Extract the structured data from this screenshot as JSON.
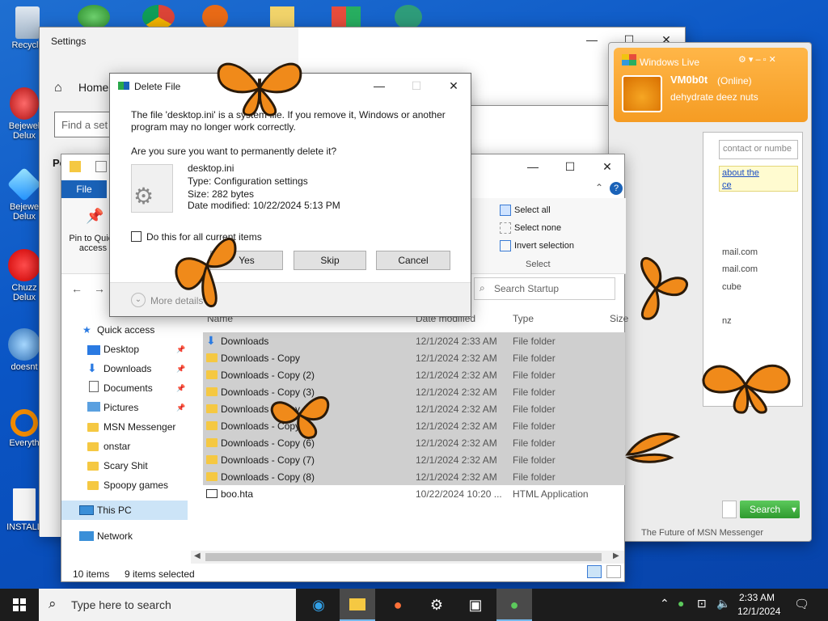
{
  "desktop": {
    "icons": [
      {
        "label": "Recycle"
      },
      {
        "label": "Bejewel\nDelux"
      },
      {
        "label": "Bejewe\nDelux"
      },
      {
        "label": "Chuzz\nDelux"
      },
      {
        "label": "doesnt"
      },
      {
        "label": "Everyth"
      },
      {
        "label": "INSTALL"
      }
    ]
  },
  "settings": {
    "title": "Settings",
    "home": "Home",
    "search_placeholder": "Find a set",
    "partial_label": "Pe"
  },
  "explorer": {
    "ribbon_file": "File",
    "pin_label": "Pin to Quick access",
    "select_all": "Select all",
    "select_none": "Select none",
    "invert_selection": "Invert selection",
    "select_group": "Select",
    "search_placeholder": "Search Startup",
    "columns": {
      "name": "Name",
      "date": "Date modified",
      "type": "Type",
      "size": "Size"
    },
    "nav": {
      "quick_access": "Quick access",
      "items": [
        "Desktop",
        "Downloads",
        "Documents",
        "Pictures",
        "MSN Messenger",
        "onstar",
        "Scary Shit",
        "Spoopy games"
      ],
      "this_pc": "This PC",
      "network": "Network"
    },
    "files": [
      {
        "name": "Downloads",
        "date": "12/1/2024 2:33 AM",
        "type": "File folder"
      },
      {
        "name": "Downloads - Copy",
        "date": "12/1/2024 2:32 AM",
        "type": "File folder"
      },
      {
        "name": "Downloads - Copy (2)",
        "date": "12/1/2024 2:32 AM",
        "type": "File folder"
      },
      {
        "name": "Downloads - Copy (3)",
        "date": "12/1/2024 2:32 AM",
        "type": "File folder"
      },
      {
        "name": "Downloads - Copy (4)",
        "date": "12/1/2024 2:32 AM",
        "type": "File folder"
      },
      {
        "name": "Downloads - Copy (5)",
        "date": "12/1/2024 2:32 AM",
        "type": "File folder"
      },
      {
        "name": "Downloads - Copy (6)",
        "date": "12/1/2024 2:32 AM",
        "type": "File folder"
      },
      {
        "name": "Downloads - Copy (7)",
        "date": "12/1/2024 2:32 AM",
        "type": "File folder"
      },
      {
        "name": "Downloads - Copy (8)",
        "date": "12/1/2024 2:32 AM",
        "type": "File folder"
      },
      {
        "name": "boo.hta",
        "date": "10/22/2024 10:20 ...",
        "type": "HTML Application"
      }
    ],
    "status_items": "10 items",
    "status_selected": "9 items selected"
  },
  "dialog": {
    "title": "Delete File",
    "message": "The file 'desktop.ini' is a system file. If you remove it, Windows or another program may no longer work correctly.",
    "question": "Are you sure you want to permanently delete it?",
    "filename": "desktop.ini",
    "filetype": "Type: Configuration settings",
    "filesize": "Size: 282 bytes",
    "modified": "Date modified: 10/22/2024 5:13 PM",
    "checkbox": "Do this for all current items",
    "yes": "Yes",
    "skip": "Skip",
    "cancel": "Cancel",
    "more": "More details"
  },
  "messenger": {
    "brand": "Windows Live",
    "user": "VM0b0t",
    "status": "(Online)",
    "personal": "dehydrate deez nuts",
    "search_placeholder": "contact or numbe",
    "link": "about the",
    "link2": "ce",
    "contacts": [
      "mail.com",
      "mail.com",
      "cube",
      "nz"
    ],
    "search_btn": "Search",
    "footer": "The Future of MSN Messenger"
  },
  "taskbar": {
    "search_placeholder": "Type here to search",
    "time": "2:33 AM",
    "date": "12/1/2024"
  },
  "colors": {
    "desktop": "#0a55c5",
    "msn_orange": "#f7a233",
    "search_green": "#3fa53f",
    "selection": "#cfcfcf"
  }
}
